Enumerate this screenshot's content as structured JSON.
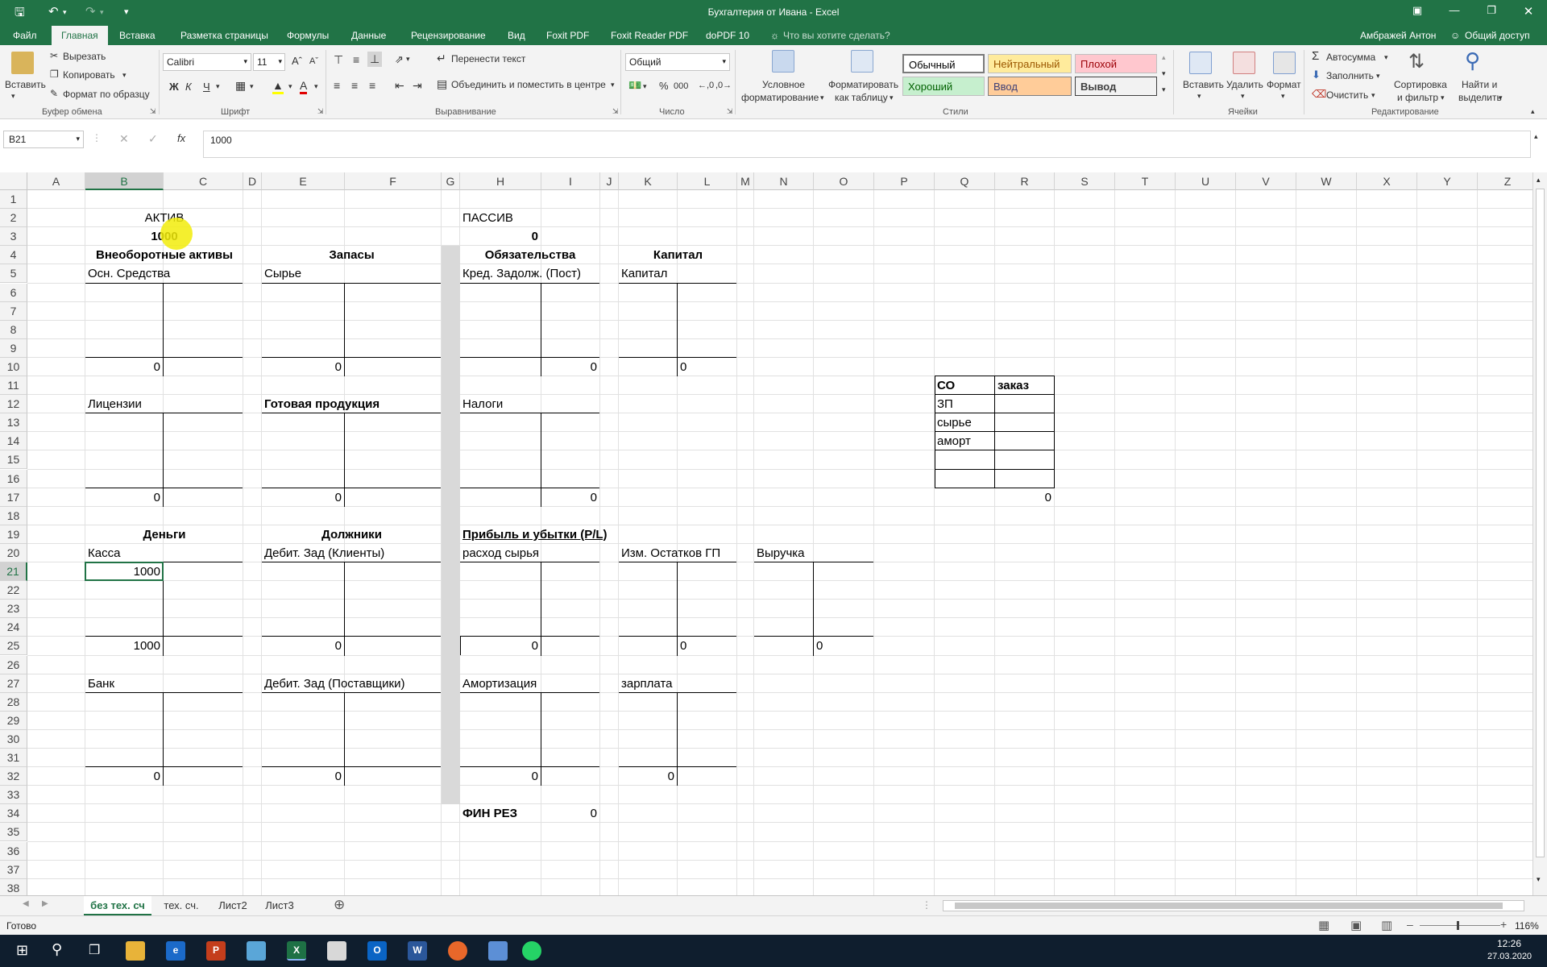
{
  "window": {
    "title": "Бухгалтерия от Ивана - Excel"
  },
  "ribbon_tabs": [
    "Файл",
    "Главная",
    "Вставка",
    "Разметка страницы",
    "Формулы",
    "Данные",
    "Рецензирование",
    "Вид",
    "Foxit PDF",
    "Foxit Reader PDF",
    "doPDF 10"
  ],
  "tell_me": "Что вы хотите сделать?",
  "account": {
    "user": "Амбражей Антон",
    "share": "Общий доступ"
  },
  "clipboard": {
    "paste": "Вставить",
    "cut": "Вырезать",
    "copy": "Копировать",
    "format_painter": "Формат по образцу",
    "group": "Буфер обмена"
  },
  "font": {
    "name": "Calibri",
    "size": "11",
    "bold": "Ж",
    "italic": "К",
    "underline": "Ч",
    "group": "Шрифт"
  },
  "alignment": {
    "wrap": "Перенести текст",
    "merge": "Объединить и поместить в центре",
    "group": "Выравнивание"
  },
  "number": {
    "format": "Общий",
    "percent": "%",
    "thousands": "000",
    "group": "Число"
  },
  "styles": {
    "conditional": [
      "Условное",
      "форматирование"
    ],
    "table": [
      "Форматировать",
      "как таблицу"
    ],
    "normal": "Обычный",
    "neutral": "Нейтральный",
    "bad": "Плохой",
    "good": "Хороший",
    "input": "Ввод",
    "output": "Вывод",
    "group": "Стили"
  },
  "cells": {
    "insert": "Вставить",
    "delete": "Удалить",
    "format": "Формат",
    "group": "Ячейки"
  },
  "editing": {
    "autosum": "Автосумма",
    "fill": "Заполнить",
    "clear": "Очистить",
    "sort": [
      "Сортировка",
      "и фильтр"
    ],
    "find": [
      "Найти и",
      "выделить"
    ],
    "group": "Редактирование"
  },
  "formula_bar": {
    "name_box": "B21",
    "fx": "fx",
    "value": "1000"
  },
  "columns": [
    "A",
    "B",
    "C",
    "D",
    "E",
    "F",
    "G",
    "H",
    "I",
    "J",
    "K",
    "L",
    "M",
    "N",
    "O",
    "P",
    "Q",
    "R",
    "S",
    "T",
    "U",
    "V",
    "W",
    "X",
    "Y",
    "Z"
  ],
  "rows": [
    "1",
    "2",
    "3",
    "4",
    "5",
    "6",
    "7",
    "8",
    "9",
    "10",
    "11",
    "12",
    "13",
    "14",
    "15",
    "16",
    "17",
    "18",
    "19",
    "20",
    "21",
    "22",
    "23",
    "24",
    "25",
    "26",
    "27",
    "28",
    "29",
    "30",
    "31",
    "32",
    "33",
    "34",
    "35",
    "36",
    "37",
    "38"
  ],
  "sheet": {
    "aktiv": "АКТИВ",
    "aktiv_total": "1000",
    "passiv": "ПАССИВ",
    "passiv_total": "0",
    "non_current": "Внеоборотные активы",
    "stocks": "Запасы",
    "liabilities": "Обязательства",
    "capital_head": "Капитал",
    "fixed_assets": "Осн. Средства",
    "raw": "Сырье",
    "supplier_credit": "Кред. Задолж. (Пост)",
    "capital": "Капитал",
    "fixed_assets_bal": "0",
    "raw_bal": "0",
    "supplier_credit_bal": "0",
    "capital_bal": "0",
    "licenses": "Лицензии",
    "finished_goods": "Готовая продукция",
    "taxes": "Налоги",
    "licenses_bal": "0",
    "finished_goods_bal": "0",
    "taxes_bal": "0",
    "money": "Деньги",
    "debtors": "Должники",
    "pl": "Прибыль и убытки (P/L)",
    "cash": "Касса",
    "cash_debit": "1000",
    "cash_bal": "1000",
    "clients_debt": "Дебит. Зад (Клиенты)",
    "clients_debt_bal": "0",
    "raw_expense": "расход сырья",
    "raw_expense_bal": "0",
    "fg_change": "Изм. Остатков ГП",
    "fg_change_bal": "0",
    "revenue": "Выручка",
    "revenue_bal": "0",
    "bank": "Банк",
    "bank_bal": "0",
    "suppliers_debt": "Дебит. Зад (Поставщики)",
    "suppliers_debt_bal": "0",
    "depreciation": "Амортизация",
    "depreciation_bal": "0",
    "salary": "зарплата",
    "salary_bal": "0",
    "fin_res": "ФИН РЕЗ",
    "fin_res_val": "0",
    "co_table": {
      "h1": "СО",
      "h2": "заказ",
      "rows": [
        "ЗП",
        "сырье",
        "аморт"
      ],
      "total": "0"
    }
  },
  "sheet_tabs": [
    "без тех. сч",
    "тех. сч.",
    "Лист2",
    "Лист3"
  ],
  "status": {
    "ready": "Готово",
    "zoom": "116%"
  },
  "taskbar": {
    "time": "12:26",
    "date": "27.03.2020"
  }
}
